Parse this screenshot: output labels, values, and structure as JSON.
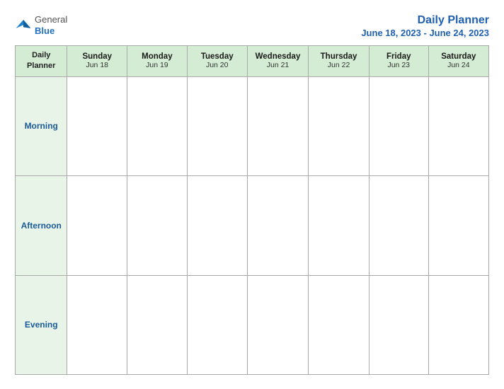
{
  "logo": {
    "general": "General",
    "blue": "Blue"
  },
  "title": {
    "main": "Daily Planner",
    "date_range": "June 18, 2023 - June 24, 2023"
  },
  "header": {
    "label": "Daily Planner",
    "days": [
      {
        "name": "Sunday",
        "date": "Jun 18"
      },
      {
        "name": "Monday",
        "date": "Jun 19"
      },
      {
        "name": "Tuesday",
        "date": "Jun 20"
      },
      {
        "name": "Wednesday",
        "date": "Jun 21"
      },
      {
        "name": "Thursday",
        "date": "Jun 22"
      },
      {
        "name": "Friday",
        "date": "Jun 23"
      },
      {
        "name": "Saturday",
        "date": "Jun 24"
      }
    ]
  },
  "rows": [
    {
      "label": "Morning"
    },
    {
      "label": "Afternoon"
    },
    {
      "label": "Evening"
    }
  ]
}
